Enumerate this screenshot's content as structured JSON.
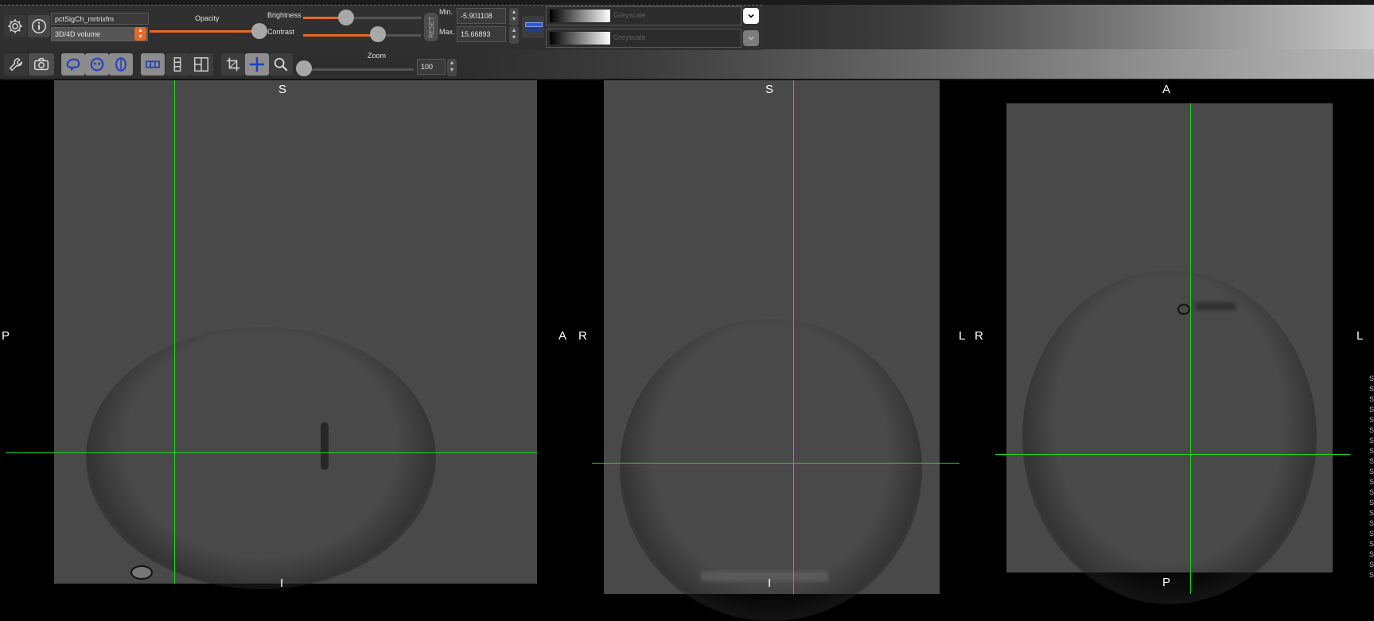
{
  "app": {
    "layer_name": "pctSigCh_mrtrixfm",
    "volume_type": "3D/4D volume"
  },
  "toolbar": {
    "opacity_label": "Opacity",
    "opacity_value_pct": 100,
    "brightness_label": "Brightness",
    "brightness_value_pct": 33,
    "contrast_label": "Contrast",
    "contrast_value_pct": 62,
    "reset_label": "RESET",
    "min_label": "Min.",
    "min_value": "-5.901108",
    "max_label": "Max.",
    "max_value": "15.66893",
    "colormap_primary": "Greyscale",
    "colormap_secondary": "Greyscale",
    "zoom_label": "Zoom",
    "zoom_value": "100",
    "zoom_slider_pct": 0
  },
  "colors": {
    "accent_orange": "#e8672a",
    "crosshair_green": "#1bd81b",
    "blue_icon": "#2d5bd6",
    "pane_gray": "#494949"
  },
  "icons": {
    "row1": [
      "gear-icon",
      "info-icon"
    ],
    "row2": [
      "wrench-icon",
      "camera-icon",
      "brain-sagittal-icon",
      "brain-coronal-icon",
      "brain-axial-icon",
      "layout-horizontal-icon",
      "layout-vertical-icon",
      "layout-grid-icon",
      "crop-icon",
      "crosshair-icon",
      "magnifier-icon"
    ]
  },
  "views": {
    "sagittal": {
      "top": "S",
      "bottom": "I",
      "left": "P",
      "right": "A"
    },
    "coronal": {
      "top": "S",
      "bottom": "I",
      "left": "R",
      "right": "L"
    },
    "axial": {
      "top": "A",
      "bottom": "P",
      "left": "R",
      "right": "L"
    }
  },
  "right_edge": [
    "S",
    "S",
    "S",
    "S",
    "S",
    "S",
    "S",
    "S",
    "S",
    "S",
    "S",
    "S",
    "S",
    "S",
    "S",
    "S",
    "S",
    "S",
    "S",
    "S"
  ]
}
